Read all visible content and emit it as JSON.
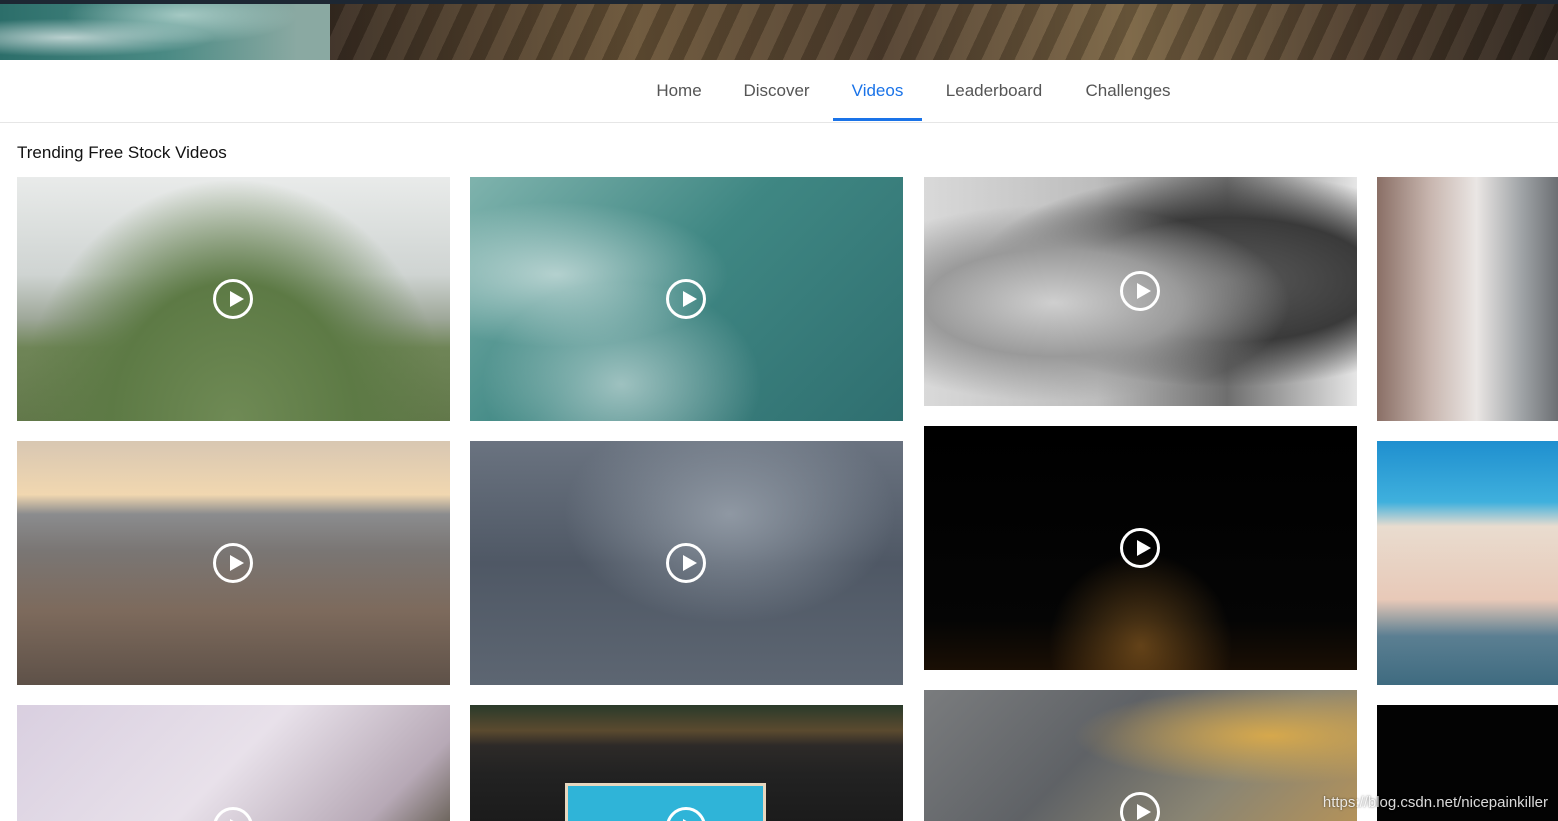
{
  "nav": {
    "tabs": [
      {
        "label": "Home",
        "active": false
      },
      {
        "label": "Discover",
        "active": false
      },
      {
        "label": "Videos",
        "active": true
      },
      {
        "label": "Leaderboard",
        "active": false
      },
      {
        "label": "Challenges",
        "active": false
      }
    ]
  },
  "section": {
    "title": "Trending Free Stock Videos"
  },
  "videos": [
    {
      "theme": "snowy-trees-field"
    },
    {
      "theme": "ocean-surfers-aerial"
    },
    {
      "theme": "couple-black-white"
    },
    {
      "theme": "door-handle"
    },
    {
      "theme": "coastal-town-sunset"
    },
    {
      "theme": "storm-clouds"
    },
    {
      "theme": "city-tower-night"
    },
    {
      "theme": "beach-boardwalk"
    },
    {
      "theme": "snowy-slope-aerial"
    },
    {
      "theme": "pool-aerial"
    },
    {
      "theme": "quarry-trucks-aerial"
    },
    {
      "theme": "dark-video"
    }
  ],
  "watermark": "https://blog.csdn.net/nicepainkiller",
  "colors": {
    "accent": "#1a73e8",
    "nav_text": "#555555",
    "divider": "#e6e6e6"
  }
}
